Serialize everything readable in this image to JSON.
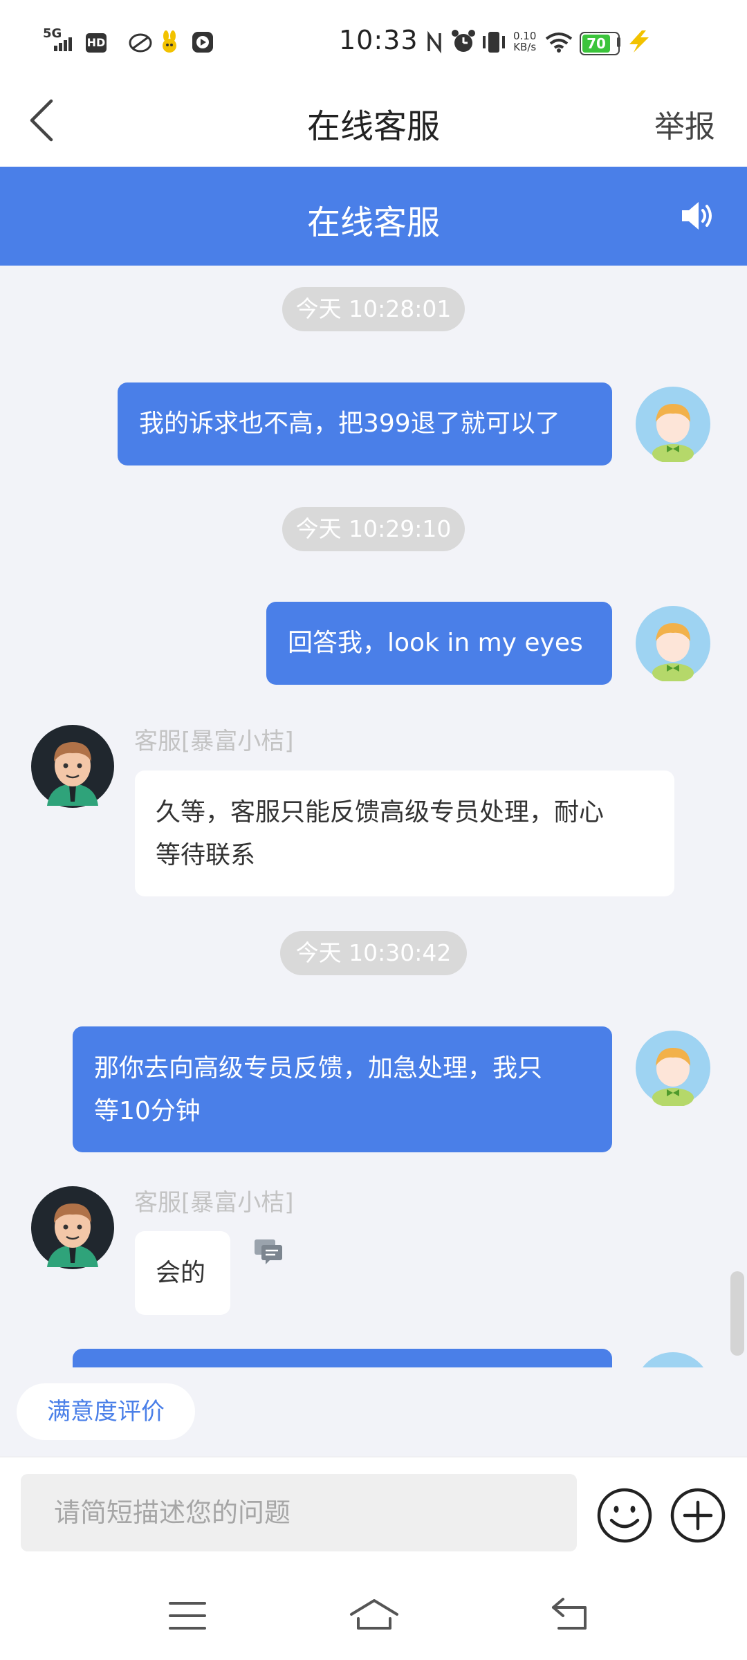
{
  "status_bar": {
    "time": "10:33",
    "network": "5G",
    "hd": "HD",
    "speed_value": "0.10",
    "speed_unit": "KB/s",
    "battery": "70"
  },
  "nav": {
    "title": "在线客服",
    "report_label": "举报"
  },
  "header": {
    "title": "在线客服"
  },
  "chat": {
    "messages": [
      {
        "type": "timestamp",
        "text": "今天 10:28:01"
      },
      {
        "type": "outgoing",
        "text": "我的诉求也不高，把399退了就可以了"
      },
      {
        "type": "timestamp",
        "text": "今天 10:29:10"
      },
      {
        "type": "outgoing",
        "text": "回答我，look in my eyes"
      },
      {
        "type": "incoming",
        "sender": "客服[暴富小桔]",
        "line1": "久等，客服只能反馈高级专员处理，耐心",
        "line2": "等待联系"
      },
      {
        "type": "timestamp",
        "text": "今天 10:30:42"
      },
      {
        "type": "outgoing",
        "line1": "那你去向高级专员反馈，加急处理，我只",
        "line2": "等10分钟"
      },
      {
        "type": "incoming",
        "sender": "客服[暴富小桔]",
        "text": "会的"
      }
    ]
  },
  "rating_button": "满意度评价",
  "input": {
    "placeholder": "请简短描述您的问题"
  },
  "colors": {
    "accent": "#4a7fe8",
    "chat_background": "#f2f3f8",
    "timestamp_pill": "#d9d9d9"
  },
  "icons": [
    "back-arrow-icon",
    "speaker-icon",
    "user-avatar",
    "agent-avatar",
    "feedback-icon",
    "emoji-icon",
    "plus-icon",
    "menu-icon",
    "home-icon",
    "back-icon"
  ]
}
